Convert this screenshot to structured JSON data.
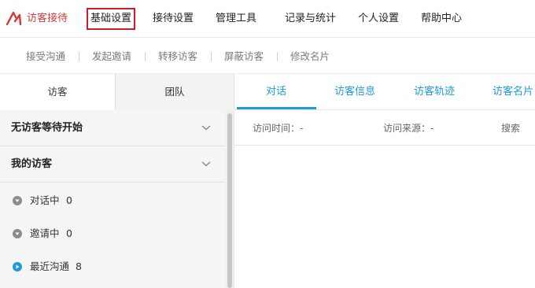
{
  "brand": {
    "name": "访客接待",
    "color": "#d43a3a"
  },
  "nav": {
    "items": [
      "基础设置",
      "接待设置",
      "管理工具",
      "记录与统计",
      "个人设置",
      "帮助中心"
    ],
    "active_index": 0,
    "active_border_color": "#c81e2b"
  },
  "subnav": {
    "items": [
      "接受沟通",
      "发起邀请",
      "转移访客",
      "屏蔽访客",
      "修改名片"
    ]
  },
  "left_tabs": {
    "visitor": "访客",
    "team": "团队"
  },
  "sections": {
    "waiting": "无访客等待开始",
    "mine": "我的访客"
  },
  "statuses": [
    {
      "label": "对话中",
      "count": "0",
      "color": "#8c8c8c"
    },
    {
      "label": "邀请中",
      "count": "0",
      "color": "#8c8c8c"
    },
    {
      "label": "最近沟通",
      "count": "8",
      "color": "#1e9bd7"
    }
  ],
  "right_tabs": [
    "对话",
    "访客信息",
    "访客轨迹",
    "访客名片"
  ],
  "right_active_index": 0,
  "info_bar": {
    "visit_time": "访问时间：-",
    "visit_source": "访问来源：-",
    "search": "搜索"
  },
  "accent_color": "#1e9bd7"
}
